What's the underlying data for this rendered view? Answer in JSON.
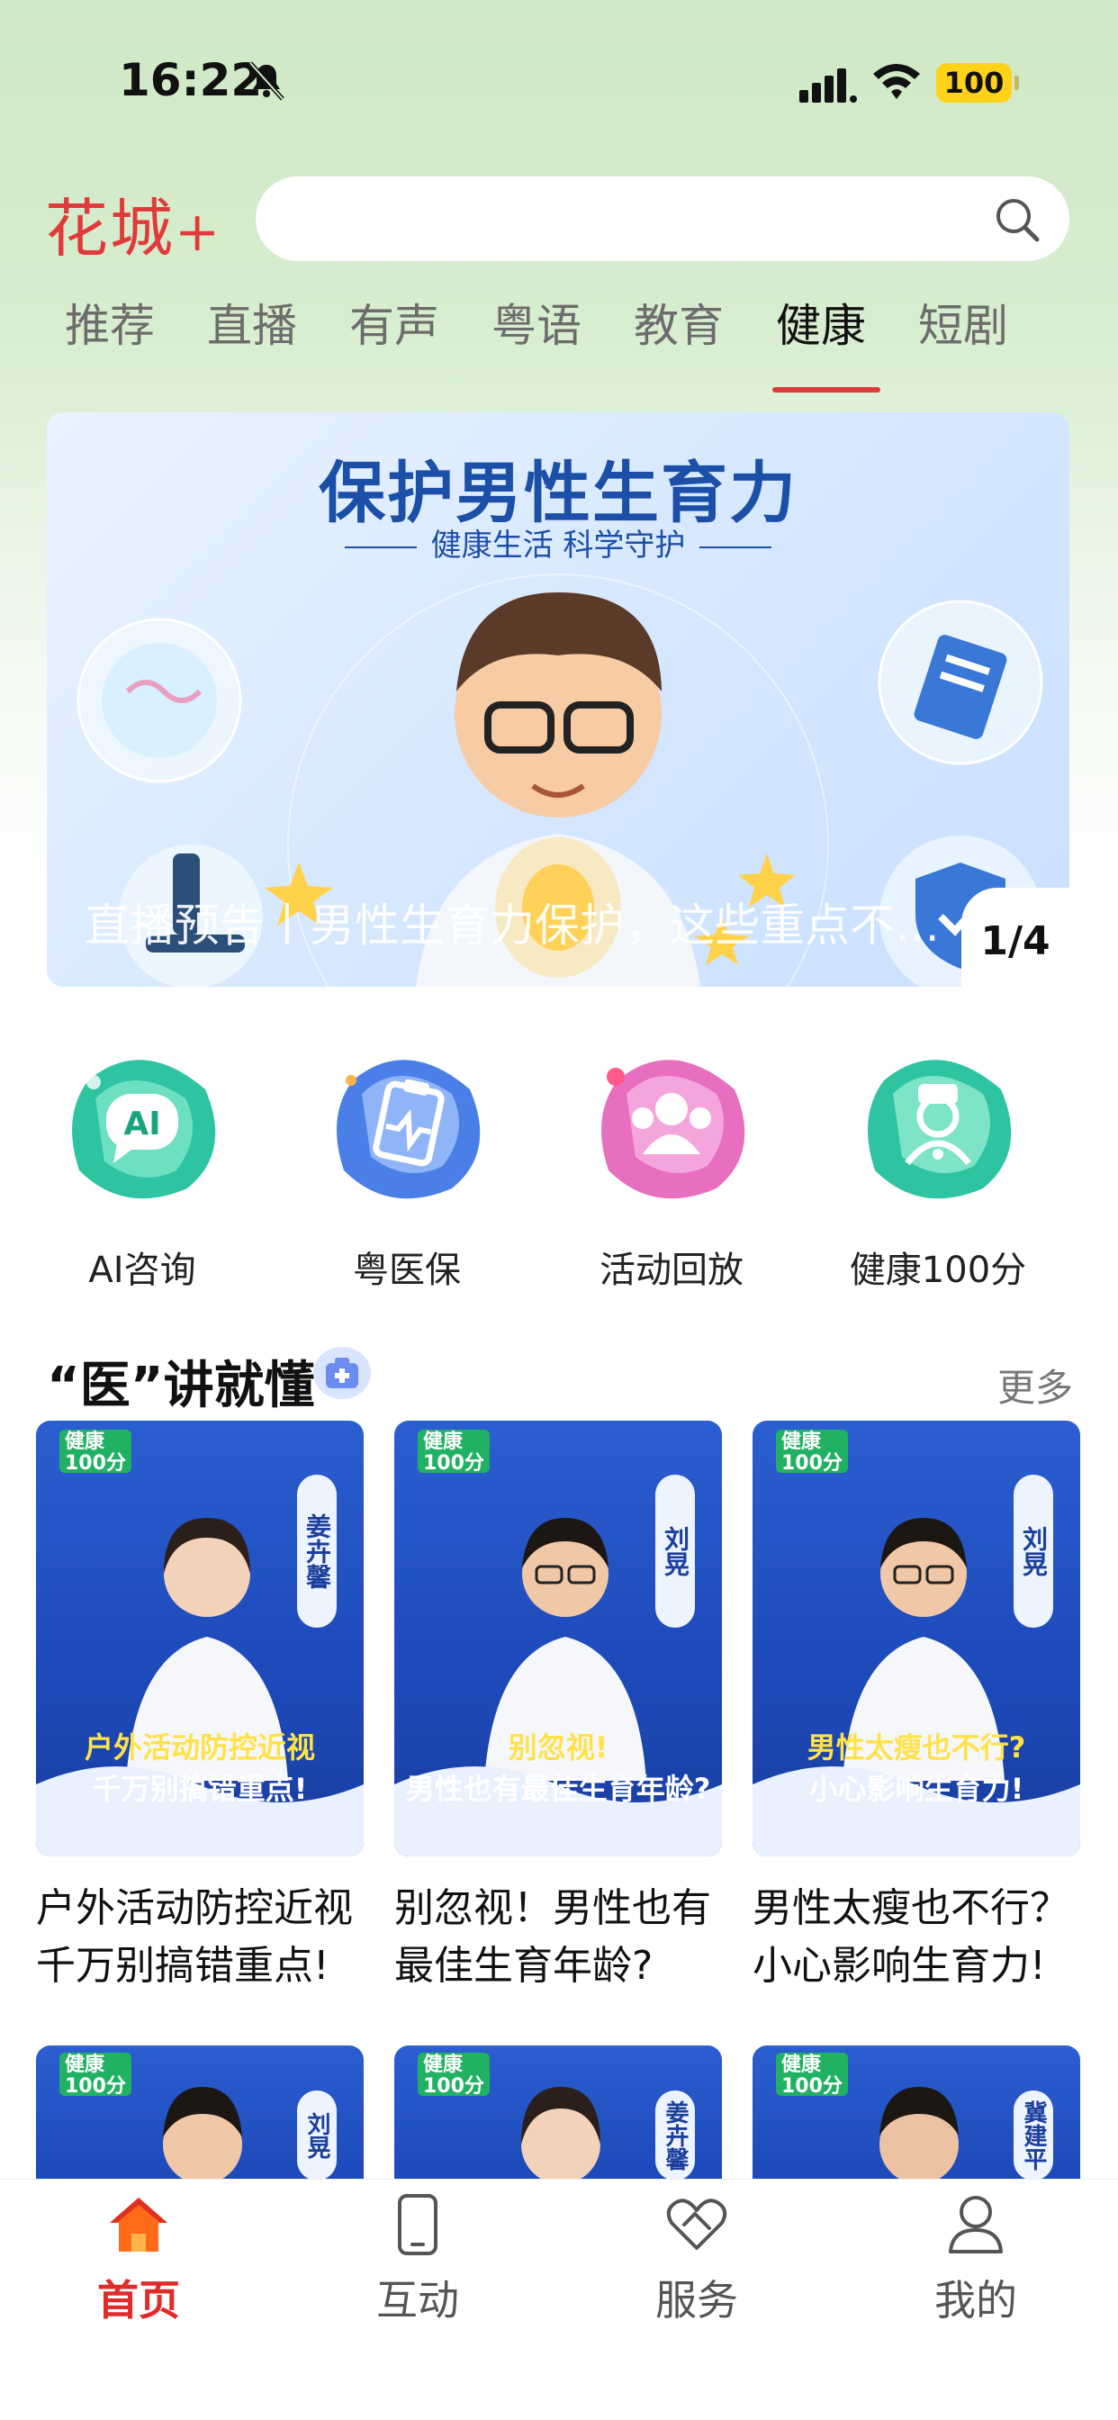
{
  "status": {
    "time": "16:22",
    "battery": "100"
  },
  "header": {
    "logo": "花城",
    "logo_plus": "+",
    "search": {
      "placeholder": ""
    }
  },
  "tabs": [
    {
      "label": "推荐",
      "active": false
    },
    {
      "label": "直播",
      "active": false
    },
    {
      "label": "有声",
      "active": false
    },
    {
      "label": "粤语",
      "active": false
    },
    {
      "label": "教育",
      "active": false
    },
    {
      "label": "健康",
      "active": true
    },
    {
      "label": "短剧",
      "active": false
    }
  ],
  "banner": {
    "title": "保护男性生育力",
    "subtitle": "健康生活 科学守护",
    "caption": "直播预告丨男性生育力保护，这些重点不…",
    "pager": "1/4"
  },
  "quick_entries": [
    {
      "label": "AI咨询",
      "icon": "ai-chat-icon",
      "color": "#2ec4a2"
    },
    {
      "label": "粤医保",
      "icon": "medical-insurance-icon",
      "color": "#4a7fe8"
    },
    {
      "label": "活动回放",
      "icon": "group-replay-icon",
      "color": "#e86fc0"
    },
    {
      "label": "健康100分",
      "icon": "doctor-icon",
      "color": "#2ec4a2"
    }
  ],
  "section": {
    "title": "“医”讲就懂",
    "more": "更多"
  },
  "cards": [
    {
      "title": "户外活动防控近视 千万别搞错重点!",
      "tag": "健康100分",
      "doctor": "姜卉馨",
      "overlay_line1": "户外活动防控近视",
      "overlay_line2": "千万别搞错重点!"
    },
    {
      "title": "别忽视！男性也有最佳生育年龄?",
      "tag": "健康100分",
      "doctor": "刘晃",
      "overlay_line1": "别忽视!",
      "overlay_line2": "男性也有最佳生育年龄?"
    },
    {
      "title": "男性太瘦也不行？小心影响生育力!",
      "tag": "健康100分",
      "doctor": "刘晃",
      "overlay_line1": "男性太瘦也不行?",
      "overlay_line2": "小心影响生育力!"
    }
  ],
  "cards_row2": [
    {
      "tag": "健康100分",
      "doctor": "刘晃"
    },
    {
      "tag": "健康100分",
      "doctor": "姜卉馨"
    },
    {
      "tag": "健康100分",
      "doctor": "冀建平"
    }
  ],
  "bottom_nav": [
    {
      "label": "首页",
      "icon": "home-icon",
      "active": true
    },
    {
      "label": "互动",
      "icon": "phone-icon",
      "active": false
    },
    {
      "label": "服务",
      "icon": "heart-hands-icon",
      "active": false
    },
    {
      "label": "我的",
      "icon": "user-icon",
      "active": false
    }
  ],
  "colors": {
    "accent": "#e03a3a",
    "nav_active": "#e02b2b",
    "banner_title": "#1b4fa8"
  }
}
